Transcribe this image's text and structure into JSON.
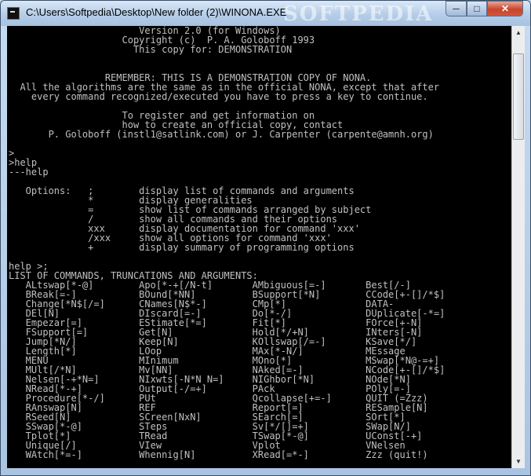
{
  "window": {
    "title": "C:\\Users\\Softpedia\\Desktop\\New folder (2)\\WINONA.EXE",
    "watermark": "SOFTPEDIA",
    "minimize_glyph": "─",
    "maximize_glyph": "□",
    "close_glyph": "✕",
    "title_icon": "console-icon"
  },
  "scrollbar": {
    "up_glyph": "▲",
    "down_glyph": "▼"
  },
  "console": {
    "lines": [
      "                       Version 2.0 (for Windows)",
      "                    Copyright (c)  P. A. Goloboff 1993",
      "                      This copy for: DEMONSTRATION",
      "",
      "",
      "                 REMEMBER: THIS IS A DEMONSTRATION COPY OF NONA.",
      "  All the algorithms are the same as in the official NONA, except that after",
      "    every command recognized/executed you have to press a key to continue.",
      "",
      "                    To register and get information on",
      "                    how to create an official copy, contact",
      "       P. Goloboff (instl1@satlink.com) or J. Carpenter (carpente@amnh.org)",
      "",
      ">",
      ">help",
      "---help",
      "",
      "   Options:   ;        display list of commands and arguments",
      "              *        display generalities",
      "              =        show list of commands arranged by subject",
      "              /        show all commands and their options",
      "              xxx      display documentation for command 'xxx'",
      "              /xxx     show all options for command 'xxx'",
      "              +        display summary of programming options",
      "",
      "help >;",
      "LIST OF COMMANDS, TRUNCATIONS AND ARGUMENTS:",
      "   ALtswap[*-@]        Apo[*-+[/N-t]       AMbiguous[=-]       Best[/-]",
      "   BReak[=-]           BOund[*NN]          BSupport[*N]        CCode[+-[]/*$]",
      "   Change[*N$[/=]      CNames[N$*-]        CMp[*]              DATA-",
      "   DEl[N]              DIscard[=-]         Do[*-/]             DUplicate[-*=]",
      "   Empezar[=]          EStimate[*=]        Fit[*]              FOrce[+-N]",
      "   FSupport[=]         Get[N]              Hold[*/+N]          INters[-N]",
      "   Jump[*N/]           Keep[N]             KOllswap[/=-]       KSave[*/]",
      "   Length[*]           LOop                MAx[*-N/]           MEssage",
      "   MENU                MInimum             MOno[*]             MSwap[*N@-=+]",
      "   MUlt[/*N]           Mv[NN]              NAked[=-]           NCode[+-[]/*$]",
      "   Nelsen[-+*N=]       NIxwts[-N*N N=]     NIGhbor[*N]         NOde[*N]",
      "   NRead[*-+]          Output[-/=+]        PAck                POly[=-]",
      "   Procedure[*-/]      PUt                 Qcollapse[+=-]      QUIT (=Zzz)",
      "   RAnswap[N]          REF                 Report[=]           RESample[N]",
      "   RSeed[N]            SCreen[NxN]         SEarch[=]           SOrt[*]",
      "   SSwap[*-@]          STeps               Sv[*/[]=+]          SWap[N/]",
      "   Tplot[*]            TRead               TSwap[*-@]          UConst[-+]",
      "   Unique[/]           VIew                Vplot               VNelsen",
      "   WAtch[*=-]          Whennig[N]          XRead[=*-]          Zzz (quit!)"
    ]
  }
}
